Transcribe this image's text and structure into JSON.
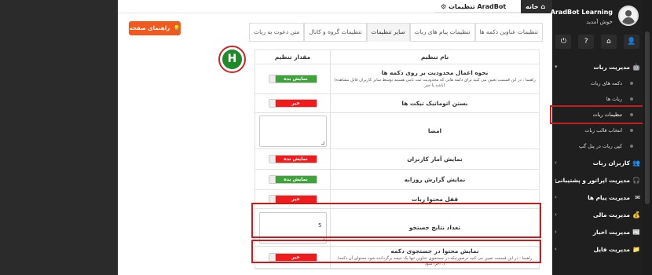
{
  "topbar": {
    "home_label": "خانه",
    "settings_tab_label": "تنظیمات AradBot Learning"
  },
  "help_button": "راهنمای صفحه",
  "tabs": [
    {
      "label": "تنظیمات عناوین دکمه ها",
      "active": false
    },
    {
      "label": "تنظیمات پیام های ربات",
      "active": false
    },
    {
      "label": "سایر تنظیمات",
      "active": true
    },
    {
      "label": "تنظیمات گروه و کانال",
      "active": false
    },
    {
      "label": "متن دعوت به ربات",
      "active": false
    }
  ],
  "table": {
    "col_name": "نام تنظیم",
    "col_value": "مقدار تنظیم",
    "rows": [
      {
        "name": "نحوه اعمال محدودیت بر روی دکمه ها",
        "desc": "(راهنما : در این قسمت تعیین می کنید برای دکمه هایی که محدودیت ثبت نامی هستند توسط سایر کاربران قابل مشاهده باشد یا خیر)",
        "type": "toggle",
        "value": "نمایش بده",
        "color": "green"
      },
      {
        "name": "بستن اتوماتیک تیکت ها",
        "desc": "",
        "type": "toggle",
        "value": "خیر",
        "color": "red"
      },
      {
        "name": "امضا",
        "desc": "",
        "type": "textarea",
        "value": ""
      },
      {
        "name": "نمایش آمار کاربران",
        "desc": "",
        "type": "toggle",
        "value": "نمایش نده",
        "color": "red"
      },
      {
        "name": "نمایش گزارش روزانه",
        "desc": "",
        "type": "toggle",
        "value": "نمایش بده",
        "color": "green"
      },
      {
        "name": "قفل محتوا ربات",
        "desc": "",
        "type": "toggle",
        "value": "خیر",
        "color": "red"
      },
      {
        "name": "تعداد نتایج جستجو",
        "desc": "",
        "type": "textarea",
        "value": "5"
      },
      {
        "name": "نمایش محتوا در جستجوی دکمه",
        "desc": "(راهنما : در این قسمت تعیین می کنید درصورتیکه در جستجوی عناوین تنها یک نتیجه برگردانده شود محتوای آن دکمه اجرا شود .)",
        "type": "toggle",
        "value": "خیر",
        "color": "red"
      }
    ]
  },
  "sidebar": {
    "title": "AradBot Learning",
    "subtitle": "خوش آمدید",
    "menu": [
      {
        "label": "مدیریت ربات",
        "bold": true,
        "expanded": true
      },
      {
        "label": "کاربران ربات",
        "bold": true
      },
      {
        "label": "مدیریت اپراتور و پشتیبانی",
        "bold": true
      },
      {
        "label": "مدیریت پیام ها",
        "bold": true
      },
      {
        "label": "مدیریت مالی",
        "bold": true
      },
      {
        "label": "مدیریت اخبار",
        "bold": true
      },
      {
        "label": "مدیریت فایل",
        "bold": true
      }
    ],
    "submenu": [
      {
        "label": "دکمه های ربات"
      },
      {
        "label": "ربات ها"
      },
      {
        "label": "تنظیمات ربات",
        "active": true
      },
      {
        "label": "انتخاب قالب ربات"
      },
      {
        "label": "کپی ربات در پنل گپ"
      }
    ]
  }
}
